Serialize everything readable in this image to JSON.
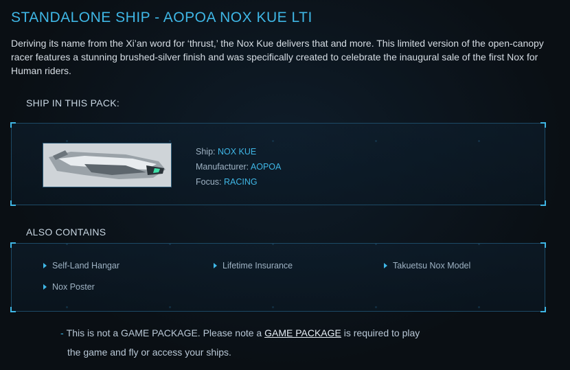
{
  "page": {
    "title": "STANDALONE SHIP - AOPOA NOX KUE LTI",
    "description": "Deriving its name from the Xi’an word for ‘thrust,’ the Nox Kue delivers that and more. This limited version of the open-canopy racer features a stunning brushed-silver finish and was specifically created to celebrate the inaugural sale of the first Nox for Human riders."
  },
  "ships_section": {
    "label": "SHIP IN THIS PACK:",
    "ship": {
      "ship_label": "Ship: ",
      "ship_value": "NOX KUE",
      "manufacturer_label": "Manufacturer: ",
      "manufacturer_value": "AOPOA",
      "focus_label": "Focus: ",
      "focus_value": "RACING"
    }
  },
  "also_contains": {
    "label": "ALSO CONTAINS",
    "items": [
      {
        "label": "Self-Land Hangar"
      },
      {
        "label": "Lifetime Insurance"
      },
      {
        "label": "Takuetsu Nox Model"
      },
      {
        "label": "Nox Poster"
      }
    ]
  },
  "notice": {
    "dash": "-",
    "text_before": "This is not a GAME PACKAGE. Please note a ",
    "link": "GAME PACKAGE",
    "text_after": " is required to play",
    "line2": "the game and fly or access your ships."
  },
  "colors": {
    "accent": "#3fb7e6",
    "background": "#0a0f14"
  }
}
